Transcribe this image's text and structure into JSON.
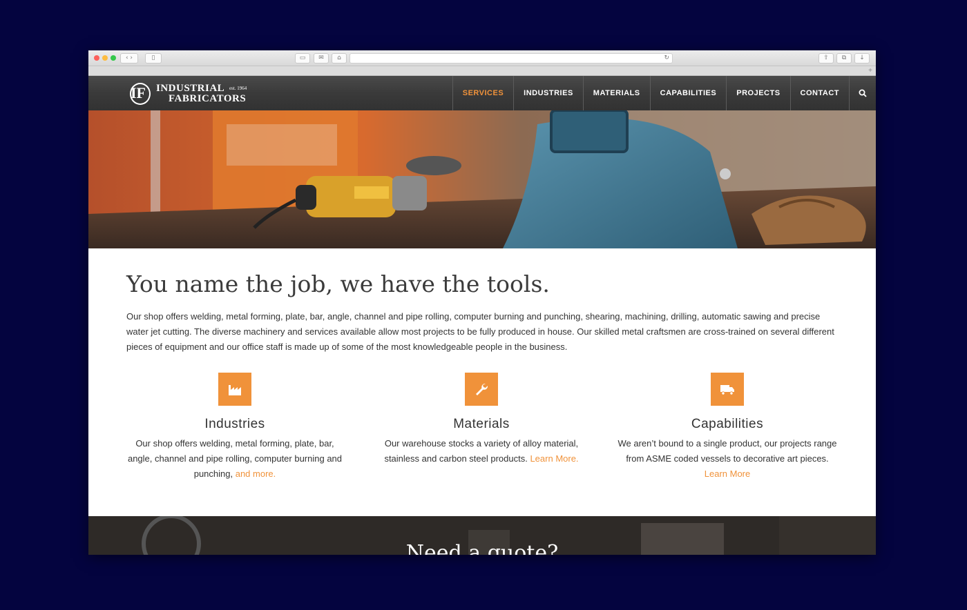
{
  "brand": {
    "logo_mark": "IF",
    "name_line1": "INDUSTRIAL",
    "name_line2": "FABRICATORS",
    "established": "est. 1964"
  },
  "nav": {
    "items": [
      {
        "label": "SERVICES",
        "active": true
      },
      {
        "label": "INDUSTRIES",
        "active": false
      },
      {
        "label": "MATERIALS",
        "active": false
      },
      {
        "label": "CAPABILITIES",
        "active": false
      },
      {
        "label": "PROJECTS",
        "active": false
      },
      {
        "label": "CONTACT",
        "active": false
      }
    ],
    "search_icon": "search-icon"
  },
  "hero": {
    "image": "welding tools on workbench"
  },
  "main": {
    "headline": "You name the job, we have the tools.",
    "intro": "Our shop offers welding, metal forming, plate, bar, angle, channel and pipe rolling, computer burning and punching, shearing, machining, drilling, automatic sawing and precise water jet cutting. The diverse machinery and services available allow most projects to be fully produced in house. Our skilled metal craftsmen are cross-trained on several different pieces of equipment and our office staff is made up of some of the most knowledgeable people in the business."
  },
  "features": [
    {
      "icon": "factory-icon",
      "title": "Industries",
      "text": "Our shop offers welding, metal forming, plate, bar, angle, channel and pipe rolling, computer burning and punching, ",
      "link": "and more."
    },
    {
      "icon": "wrench-icon",
      "title": "Materials",
      "text": "Our warehouse stocks a variety of alloy material, stainless and carbon steel products. ",
      "link": "Learn More."
    },
    {
      "icon": "truck-icon",
      "title": "Capabilities",
      "text": "We aren’t bound to a single product, our projects range from ASME coded vessels to decorative art pieces. ",
      "link": "Learn More"
    }
  ],
  "quote": {
    "title": "Need a quote?"
  },
  "colors": {
    "accent": "#f0923a",
    "header_bg": "#3a3a3a",
    "page_bg": "#04043f"
  }
}
